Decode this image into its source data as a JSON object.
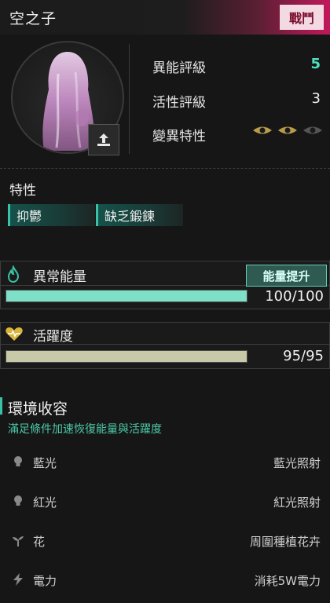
{
  "header": {
    "title": "空之子",
    "tag": "戰鬥"
  },
  "stats": {
    "anomaly_rating_label": "異能評級",
    "anomaly_rating_value": "5",
    "activity_rating_label": "活性評級",
    "activity_rating_value": "3",
    "mutation_label": "變異特性",
    "mutation_level": 2,
    "mutation_max": 3
  },
  "traits": {
    "title": "特性",
    "items": [
      "抑鬱",
      "缺乏鍛鍊"
    ]
  },
  "energy": {
    "label": "異常能量",
    "boost_label": "能量提升",
    "value_text": "100/100",
    "fill": 1.0
  },
  "activity": {
    "label": "活躍度",
    "value_text": "95/95",
    "fill": 1.0
  },
  "environment": {
    "title": "環境收容",
    "subtitle": "滿足條件加速恢復能量與活躍度",
    "rows": [
      {
        "icon": "lightbulb-icon",
        "label": "藍光",
        "value": "藍光照射"
      },
      {
        "icon": "lightbulb-icon",
        "label": "紅光",
        "value": "紅光照射"
      },
      {
        "icon": "sprout-icon",
        "label": "花",
        "value": "周圍種植花卉"
      },
      {
        "icon": "lightning-icon",
        "label": "電力",
        "value": "消耗5W電力"
      }
    ]
  },
  "colors": {
    "accent": "#39c3a6",
    "rating_highlight": "#4fe0c0",
    "energy_bar": "#7fe0c8",
    "activity_bar": "#c8c9a8",
    "battle_tag_bg": "#f3d9e2"
  }
}
